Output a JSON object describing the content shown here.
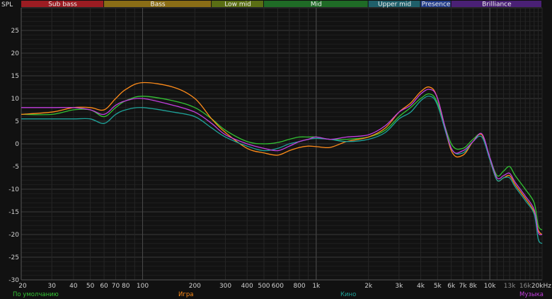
{
  "chart_data": {
    "type": "line",
    "ylabel": "SPL",
    "xunit": "kHz",
    "xlim": [
      20,
      20000
    ],
    "ylim": [
      -30,
      30
    ],
    "xscale": "log",
    "grid": true,
    "bands": [
      {
        "label": "Sub bass",
        "from": 20,
        "to": 60,
        "color": "#9b1c22"
      },
      {
        "label": "Bass",
        "from": 60,
        "to": 250,
        "color": "#8a6d16"
      },
      {
        "label": "Low mid",
        "from": 250,
        "to": 500,
        "color": "#5a6e14"
      },
      {
        "label": "Mid",
        "from": 500,
        "to": 2000,
        "color": "#1f6b26"
      },
      {
        "label": "Upper mid",
        "from": 2000,
        "to": 4000,
        "color": "#1f5f6a"
      },
      {
        "label": "Presence",
        "from": 4000,
        "to": 6000,
        "color": "#233d8a"
      },
      {
        "label": "Brilliance",
        "from": 6000,
        "to": 20000,
        "color": "#4a2075"
      }
    ],
    "yticks": [
      25,
      20,
      15,
      10,
      5,
      0,
      -5,
      -10,
      -15,
      -20,
      -25,
      -30
    ],
    "xticks": [
      {
        "v": 20,
        "label": "20",
        "dim": false
      },
      {
        "v": 30,
        "label": "30",
        "dim": false
      },
      {
        "v": 40,
        "label": "40",
        "dim": false
      },
      {
        "v": 50,
        "label": "50",
        "dim": false
      },
      {
        "v": 60,
        "label": "60",
        "dim": false
      },
      {
        "v": 70,
        "label": "70",
        "dim": false
      },
      {
        "v": 80,
        "label": "80",
        "dim": false
      },
      {
        "v": 100,
        "label": "100",
        "dim": false
      },
      {
        "v": 200,
        "label": "200",
        "dim": false
      },
      {
        "v": 300,
        "label": "300",
        "dim": false
      },
      {
        "v": 400,
        "label": "400",
        "dim": false
      },
      {
        "v": 500,
        "label": "500",
        "dim": false
      },
      {
        "v": 600,
        "label": "600",
        "dim": false
      },
      {
        "v": 800,
        "label": "800",
        "dim": false
      },
      {
        "v": 1000,
        "label": "1k",
        "dim": false
      },
      {
        "v": 2000,
        "label": "2k",
        "dim": false
      },
      {
        "v": 3000,
        "label": "3k",
        "dim": false
      },
      {
        "v": 4000,
        "label": "4k",
        "dim": false
      },
      {
        "v": 5000,
        "label": "5k",
        "dim": false
      },
      {
        "v": 6000,
        "label": "6k",
        "dim": false
      },
      {
        "v": 7000,
        "label": "7k",
        "dim": false
      },
      {
        "v": 8000,
        "label": "8k",
        "dim": false
      },
      {
        "v": 10000,
        "label": "10k",
        "dim": false
      },
      {
        "v": 13000,
        "label": "13k",
        "dim": true
      },
      {
        "v": 16000,
        "label": "16k",
        "dim": true
      },
      {
        "v": 20000,
        "label": "20kHz",
        "dim": false
      }
    ],
    "series": [
      {
        "name": "По умолчанию",
        "color": "#33c233",
        "x": [
          20,
          30,
          40,
          50,
          60,
          70,
          80,
          100,
          150,
          200,
          250,
          300,
          400,
          500,
          600,
          700,
          800,
          900,
          1000,
          1200,
          1500,
          2000,
          2500,
          3000,
          3500,
          4000,
          4500,
          5000,
          6000,
          7000,
          8000,
          9000,
          10000,
          11000,
          12000,
          13000,
          14000,
          16000,
          18000,
          19000,
          20000
        ],
        "y": [
          6.5,
          6.5,
          7.5,
          7.5,
          6,
          8,
          9.5,
          10.5,
          9.5,
          8,
          5.5,
          3,
          0.5,
          0,
          0.3,
          1,
          1.5,
          1.5,
          1.5,
          1,
          1,
          1.5,
          3,
          6,
          8,
          10,
          11,
          9,
          0,
          -1,
          1,
          2,
          -3,
          -7,
          -6,
          -5,
          -7,
          -10,
          -13,
          -18,
          -19
        ]
      },
      {
        "name": "Игра",
        "color": "#ff8c1a",
        "x": [
          20,
          30,
          40,
          50,
          60,
          70,
          80,
          100,
          150,
          200,
          250,
          300,
          400,
          500,
          600,
          700,
          800,
          900,
          1000,
          1200,
          1500,
          2000,
          2500,
          3000,
          3500,
          4000,
          4500,
          5000,
          6000,
          7000,
          8000,
          9000,
          10000,
          11000,
          12000,
          13000,
          14000,
          16000,
          18000,
          19000,
          20000
        ],
        "y": [
          6.5,
          7,
          8,
          8,
          7.5,
          10,
          12,
          13.5,
          12.5,
          10,
          5.5,
          2.5,
          -1,
          -2,
          -2.5,
          -1.5,
          -0.8,
          -0.5,
          -0.6,
          -0.8,
          0.5,
          1.5,
          3.5,
          7,
          9,
          11.5,
          12.5,
          10,
          -1.5,
          -2.5,
          0.5,
          2,
          -3.5,
          -8,
          -7.5,
          -7,
          -9,
          -12,
          -15,
          -19,
          -20
        ]
      },
      {
        "name": "Кино",
        "color": "#1fa39a",
        "x": [
          20,
          30,
          40,
          50,
          60,
          70,
          80,
          100,
          150,
          200,
          250,
          300,
          400,
          500,
          600,
          700,
          800,
          900,
          1000,
          1200,
          1500,
          2000,
          2500,
          3000,
          3500,
          4000,
          4500,
          5000,
          6000,
          7000,
          8000,
          9000,
          10000,
          11000,
          12000,
          13000,
          14000,
          16000,
          18000,
          19000,
          20000
        ],
        "y": [
          5.5,
          5.5,
          5.5,
          5.5,
          4.5,
          6.5,
          7.5,
          8,
          7,
          6,
          3.5,
          1.5,
          -0.5,
          -1.5,
          -1,
          0,
          0.5,
          1,
          1.2,
          1,
          0.5,
          1,
          2.5,
          5.5,
          7,
          9.5,
          10.5,
          8.5,
          -1,
          -2,
          0.5,
          1.5,
          -3.5,
          -8,
          -7.5,
          -7.5,
          -9.5,
          -12.5,
          -15.5,
          -21,
          -22
        ]
      },
      {
        "name": "Музыка",
        "color": "#c43fe0",
        "x": [
          20,
          30,
          40,
          50,
          60,
          70,
          80,
          100,
          150,
          200,
          250,
          300,
          400,
          500,
          600,
          700,
          800,
          900,
          1000,
          1200,
          1500,
          2000,
          2500,
          3000,
          3500,
          4000,
          4500,
          5000,
          6000,
          7000,
          8000,
          9000,
          10000,
          11000,
          12000,
          13000,
          14000,
          16000,
          18000,
          19000,
          20000
        ],
        "y": [
          8,
          8,
          8,
          7.5,
          6.5,
          8.5,
          9.5,
          10,
          8.5,
          7,
          4.5,
          2,
          0,
          -1,
          -1.5,
          -0.5,
          0.5,
          1,
          1.5,
          1,
          1.5,
          2,
          4,
          7,
          8.5,
          11,
          12,
          10,
          -1,
          -1.5,
          0.5,
          2.2,
          -3,
          -7.5,
          -7,
          -6.5,
          -8.5,
          -11.5,
          -14.5,
          -19.5,
          -20
        ]
      }
    ]
  }
}
